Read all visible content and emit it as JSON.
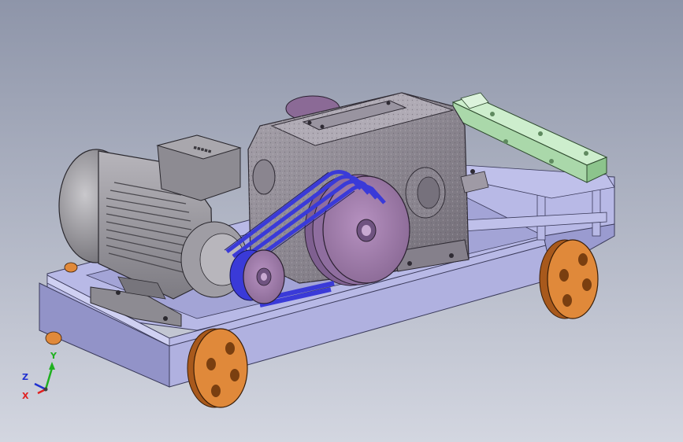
{
  "viewport": {
    "background_top": "#8e95a9",
    "background_bottom": "#d3d6e0"
  },
  "colors": {
    "frame": "#b8b9e6",
    "frame_shade": "#9293c8",
    "frame_dark": "#6f70a8",
    "wheel": "#e0893a",
    "wheel_dark": "#a8591c",
    "belt": "#3a3ad8",
    "pulley": "#a37fae",
    "gearbox": "#8f8a93",
    "motor": "#a9a7ad",
    "rail": "#bde6bd"
  },
  "triad": {
    "x_label": "X",
    "y_label": "Y",
    "z_label": "Z",
    "x_color": "#e02020",
    "y_color": "#20b020",
    "z_color": "#2030d0"
  }
}
